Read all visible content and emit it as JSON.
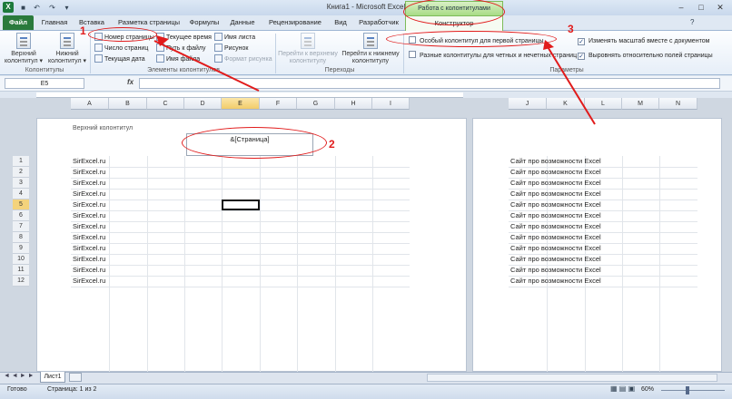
{
  "window": {
    "title": "Книга1  -  Microsoft Excel",
    "minimize": "–",
    "maximize": "□",
    "close": "✕"
  },
  "contextual_group": "Работа с колонтитулами",
  "tabs": [
    "Главная",
    "Вставка",
    "Разметка страницы",
    "Формулы",
    "Данные",
    "Рецензирование",
    "Вид",
    "Разработчик"
  ],
  "file_tab": "Файл",
  "constructor_tab": "Конструктор",
  "ribbon": {
    "header_btn": "Верхний колонтитул ▾",
    "footer_btn": "Нижний колонтитул ▾",
    "group_headers": "Колонтитулы",
    "page_number": "Номер страницы",
    "page_count": "Число страниц",
    "current_date": "Текущая дата",
    "current_time": "Текущее время",
    "file_path": "Путь к файлу",
    "file_name": "Имя файла",
    "sheet_name": "Имя листа",
    "picture": "Рисунок",
    "picture_format": "Формат рисунка",
    "group_elements": "Элементы колонтитулов",
    "goto_header": "Перейти к верхнему колонтитулу",
    "goto_footer": "Перейти к нижнему колонтитулу",
    "group_nav": "Переходы",
    "opt_first_page": "Особый колонтитул для первой страницы",
    "opt_odd_even": "Разные колонтитулы для четных и нечетных страниц",
    "opt_scale": "Изменять масштаб вместе с документом",
    "opt_align": "Выровнять относительно полей страницы",
    "opt_first_page_checked": false,
    "opt_odd_even_checked": false,
    "opt_scale_checked": true,
    "opt_align_checked": true,
    "group_params": "Параметры"
  },
  "namebox": "E5",
  "fx": "fx",
  "columns_left": [
    "A",
    "B",
    "C",
    "D",
    "E",
    "F",
    "G",
    "H",
    "I"
  ],
  "columns_right": [
    "J",
    "K",
    "L",
    "M",
    "N"
  ],
  "rows": [
    "1",
    "2",
    "3",
    "4",
    "5",
    "6",
    "7",
    "8",
    "9",
    "10",
    "11",
    "12"
  ],
  "header_label": "Верхний колонтитул",
  "header_field": "&[Страница]",
  "left_cells": [
    "SirExcel.ru",
    "SirExcel.ru",
    "SirExcel.ru",
    "SirExcel.ru",
    "SirExcel.ru",
    "SirExcel.ru",
    "SirExcel.ru",
    "SirExcel.ru",
    "SirExcel.ru",
    "SirExcel.ru",
    "SirExcel.ru",
    "SirExcel.ru"
  ],
  "right_cells": [
    "Сайт про возможности Excel",
    "Сайт про возможности Excel",
    "Сайт про возможности Excel",
    "Сайт про возможности Excel",
    "Сайт про возможности Excel",
    "Сайт про возможности Excel",
    "Сайт про возможности Excel",
    "Сайт про возможности Excel",
    "Сайт про возможности Excel",
    "Сайт про возможности Excel",
    "Сайт про возможности Excel",
    "Сайт про возможности Excel"
  ],
  "sheet_tab": "Лист1",
  "status": {
    "ready": "Готово",
    "page": "Страница: 1 из 2",
    "zoom": "60%"
  },
  "callouts": [
    "1",
    "2",
    "3"
  ],
  "colors": {
    "annotation": "#e11b1b",
    "excel_green": "#2a7a3c",
    "selected_header": "#f4d37c"
  }
}
